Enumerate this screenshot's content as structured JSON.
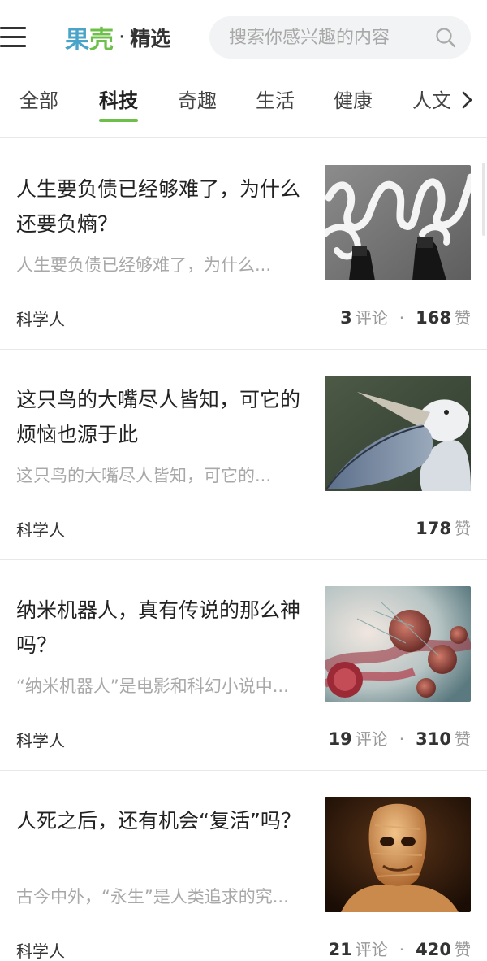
{
  "header": {
    "logo_part1": "果",
    "logo_part2": "壳",
    "logo_dot": "·",
    "logo_sub": "精选",
    "search_placeholder": "搜索你感兴趣的内容"
  },
  "tabs": [
    {
      "label": "全部",
      "active": false
    },
    {
      "label": "科技",
      "active": true
    },
    {
      "label": "奇趣",
      "active": false
    },
    {
      "label": "生活",
      "active": false
    },
    {
      "label": "健康",
      "active": false
    },
    {
      "label": "人文",
      "active": false
    }
  ],
  "articles": [
    {
      "title": "人生要负债已经够难了，为什么还要负熵？",
      "summary": "人生要负债已经够难了，为什么...",
      "source": "科学人",
      "comments": "3",
      "comments_label": "评论",
      "likes": "168",
      "likes_label": "赞",
      "image": "shoes-and-white-lines"
    },
    {
      "title": "这只鸟的大嘴尽人皆知，可它的烦恼也源于此",
      "summary": "这只鸟的大嘴尽人皆知，可它的...",
      "source": "科学人",
      "likes": "178",
      "likes_label": "赞",
      "image": "pelican-bird"
    },
    {
      "title": "纳米机器人，真有传说的那么神吗？",
      "summary": "“纳米机器人”是电影和科幻小说中...",
      "source": "科学人",
      "comments": "19",
      "comments_label": "评论",
      "likes": "310",
      "likes_label": "赞",
      "image": "nanorobots"
    },
    {
      "title": "人死之后，还有机会“复活”吗？",
      "summary": "古今中外，“永生”是人类追求的究...",
      "source": "科学人",
      "comments": "21",
      "comments_label": "评论",
      "likes": "420",
      "likes_label": "赞",
      "image": "mummy"
    }
  ],
  "stats_separator": "·",
  "colors": {
    "brand_blue": "#4aa3c8",
    "brand_green": "#6cc04a",
    "text_primary": "#222222",
    "text_secondary": "#a8a8a8",
    "divider": "#e8e8e8"
  }
}
